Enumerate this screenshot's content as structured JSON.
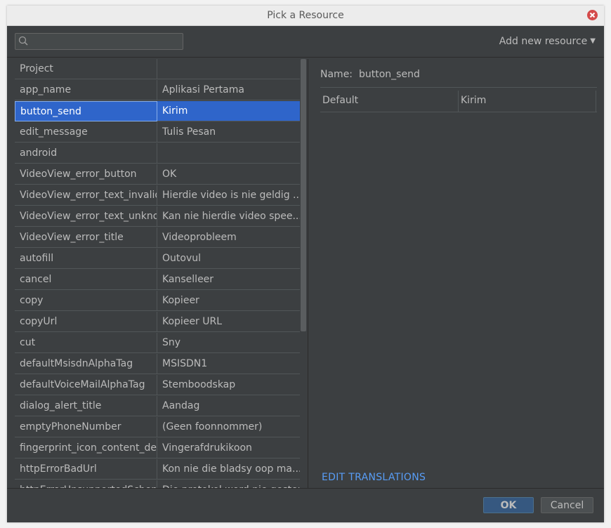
{
  "window": {
    "title": "Pick a Resource"
  },
  "search": {
    "placeholder": "",
    "value": ""
  },
  "toolbar": {
    "add_new_label": "Add new resource"
  },
  "table": {
    "rows": [
      {
        "key": "Project",
        "value": ""
      },
      {
        "key": "app_name",
        "value": "Aplikasi Pertama"
      },
      {
        "key": "button_send",
        "value": "Kirim"
      },
      {
        "key": "edit_message",
        "value": "Tulis Pesan"
      },
      {
        "key": "android",
        "value": ""
      },
      {
        "key": "VideoView_error_button",
        "value": "OK"
      },
      {
        "key": "VideoView_error_text_invalid",
        "value": "Hierdie video is nie geldig ..."
      },
      {
        "key": "VideoView_error_text_unknown",
        "value": "Kan nie hierdie video spee..."
      },
      {
        "key": "VideoView_error_title",
        "value": "Videoprobleem"
      },
      {
        "key": "autofill",
        "value": "Outovul"
      },
      {
        "key": "cancel",
        "value": "Kanselleer"
      },
      {
        "key": "copy",
        "value": "Kopieer"
      },
      {
        "key": "copyUrl",
        "value": "Kopieer URL"
      },
      {
        "key": "cut",
        "value": "Sny"
      },
      {
        "key": "defaultMsisdnAlphaTag",
        "value": "MSISDN1"
      },
      {
        "key": "defaultVoiceMailAlphaTag",
        "value": "Stemboodskap"
      },
      {
        "key": "dialog_alert_title",
        "value": "Aandag"
      },
      {
        "key": "emptyPhoneNumber",
        "value": "(Geen foonnommer)"
      },
      {
        "key": "fingerprint_icon_content_description",
        "value": "Vingerafdrukikoon"
      },
      {
        "key": "httpErrorBadUrl",
        "value": "Kon nie die bladsy oop ma..."
      },
      {
        "key": "httpErrorUnsupportedScheme",
        "value": "Die protokol word nie gesteun"
      }
    ],
    "selected_index": 2
  },
  "detail": {
    "name_label": "Name:",
    "name_value": "button_send",
    "translations": [
      {
        "locale": "Default",
        "value": "Kirim"
      }
    ],
    "edit_translations_label": "EDIT TRANSLATIONS"
  },
  "footer": {
    "ok_label": "OK",
    "cancel_label": "Cancel"
  },
  "colors": {
    "dialog_bg": "#3c3f41",
    "selection": "#2f65ca",
    "link": "#589df6",
    "text": "#bbbbbb",
    "close": "#d44a4a"
  }
}
